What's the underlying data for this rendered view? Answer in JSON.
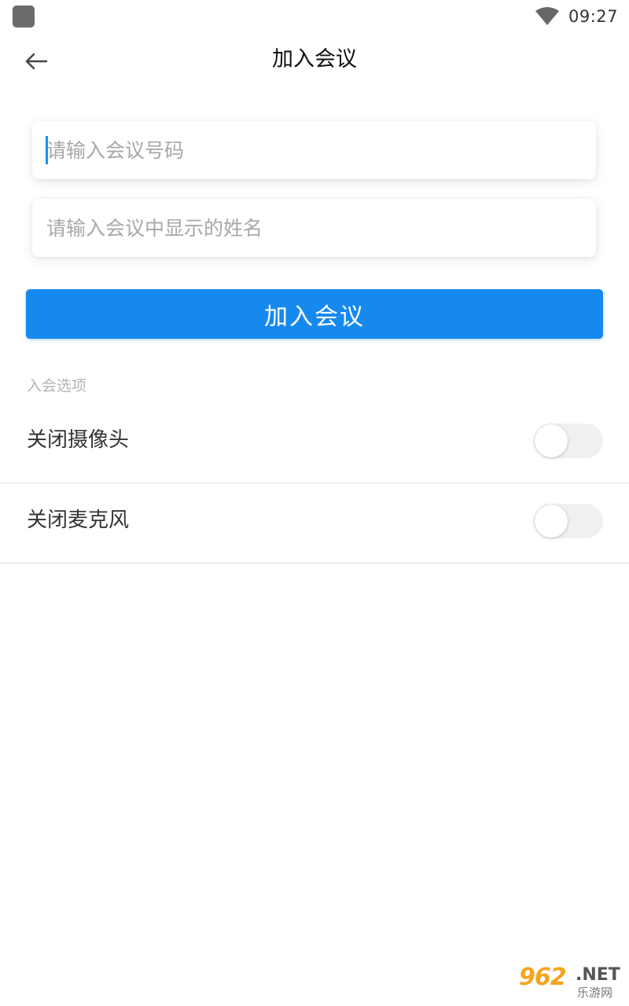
{
  "status_bar": {
    "time": "09:27",
    "icons": [
      "app-icon",
      "wifi-icon"
    ]
  },
  "header": {
    "title": "加入会议",
    "back_icon": "arrow-left-icon"
  },
  "form": {
    "meeting_number": {
      "value": "",
      "placeholder": "请输入会议号码"
    },
    "display_name": {
      "value": "",
      "placeholder": "请输入会议中显示的姓名"
    },
    "join_label": "加入会议"
  },
  "options": {
    "section_label": "入会选项",
    "items": [
      {
        "label": "关闭摄像头",
        "enabled": false
      },
      {
        "label": "关闭麦克风",
        "enabled": false
      }
    ]
  },
  "watermark": {
    "brand": "962",
    "suffix": ".NET",
    "sub": "乐游网"
  },
  "colors": {
    "accent": "#1689ee",
    "toggle_off": "#f0f0f0",
    "divider": "#e4e4e4"
  }
}
